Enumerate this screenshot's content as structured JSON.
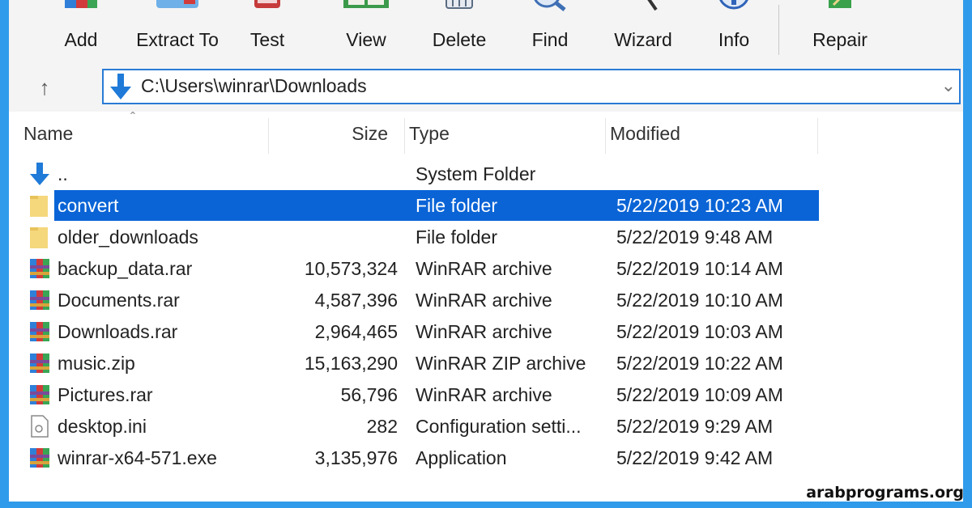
{
  "toolbar": {
    "buttons": [
      {
        "label": "Add",
        "icon": "add-icon"
      },
      {
        "label": "Extract To",
        "icon": "extract-to-icon"
      },
      {
        "label": "Test",
        "icon": "test-icon"
      },
      {
        "label": "View",
        "icon": "view-icon"
      },
      {
        "label": "Delete",
        "icon": "delete-icon"
      },
      {
        "label": "Find",
        "icon": "find-icon"
      },
      {
        "label": "Wizard",
        "icon": "wizard-icon"
      },
      {
        "label": "Info",
        "icon": "info-icon"
      },
      {
        "label": "Repair",
        "icon": "repair-icon"
      }
    ]
  },
  "address": {
    "path": "C:\\Users\\winrar\\Downloads"
  },
  "columns": {
    "name": "Name",
    "size": "Size",
    "type": "Type",
    "modified": "Modified"
  },
  "files": [
    {
      "name": "..",
      "size": "",
      "type": "System Folder",
      "modified": "",
      "icon": "parent-folder-icon"
    },
    {
      "name": "convert",
      "size": "",
      "type": "File folder",
      "modified": "5/22/2019 10:23 AM",
      "icon": "folder-icon",
      "selected": true
    },
    {
      "name": "older_downloads",
      "size": "",
      "type": "File folder",
      "modified": "5/22/2019 9:48 AM",
      "icon": "folder-icon"
    },
    {
      "name": "backup_data.rar",
      "size": "10,573,324",
      "type": "WinRAR archive",
      "modified": "5/22/2019 10:14 AM",
      "icon": "rar-archive-icon"
    },
    {
      "name": "Documents.rar",
      "size": "4,587,396",
      "type": "WinRAR archive",
      "modified": "5/22/2019 10:10 AM",
      "icon": "rar-archive-icon"
    },
    {
      "name": "Downloads.rar",
      "size": "2,964,465",
      "type": "WinRAR archive",
      "modified": "5/22/2019 10:03 AM",
      "icon": "rar-archive-icon"
    },
    {
      "name": "music.zip",
      "size": "15,163,290",
      "type": "WinRAR ZIP archive",
      "modified": "5/22/2019 10:22 AM",
      "icon": "rar-archive-icon"
    },
    {
      "name": "Pictures.rar",
      "size": "56,796",
      "type": "WinRAR archive",
      "modified": "5/22/2019 10:09 AM",
      "icon": "rar-archive-icon"
    },
    {
      "name": "desktop.ini",
      "size": "282",
      "type": "Configuration setti...",
      "modified": "5/22/2019 9:29 AM",
      "icon": "settings-file-icon"
    },
    {
      "name": "winrar-x64-571.exe",
      "size": "3,135,976",
      "type": "Application",
      "modified": "5/22/2019 9:42 AM",
      "icon": "rar-archive-icon"
    }
  ],
  "colors": {
    "frame": "#2f9bea",
    "selection": "#0a64d6",
    "address_border": "#2a7bd6"
  },
  "watermark": "arabprograms.org"
}
